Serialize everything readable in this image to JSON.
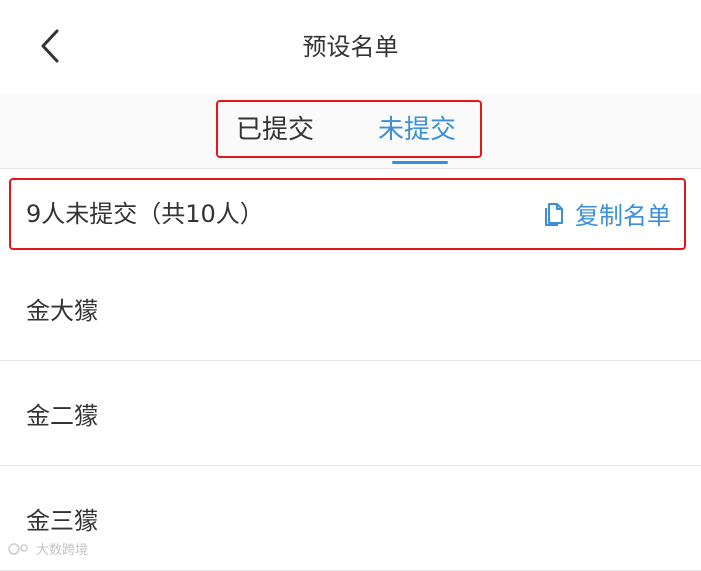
{
  "header": {
    "title": "预设名单"
  },
  "tabs": [
    {
      "label": "已提交",
      "active": false
    },
    {
      "label": "未提交",
      "active": true
    }
  ],
  "summary": {
    "text": "9人未提交（共10人）",
    "copy_label": "复制名单"
  },
  "list": [
    {
      "name": "金大獴"
    },
    {
      "name": "金二獴"
    },
    {
      "name": "金三獴"
    }
  ],
  "watermark": {
    "text": "大数跨境"
  },
  "colors": {
    "accent": "#3b8fd9",
    "highlight": "#e3161b"
  },
  "icons": {
    "back": "chevron-left-icon",
    "copy": "copy-document-icon"
  }
}
